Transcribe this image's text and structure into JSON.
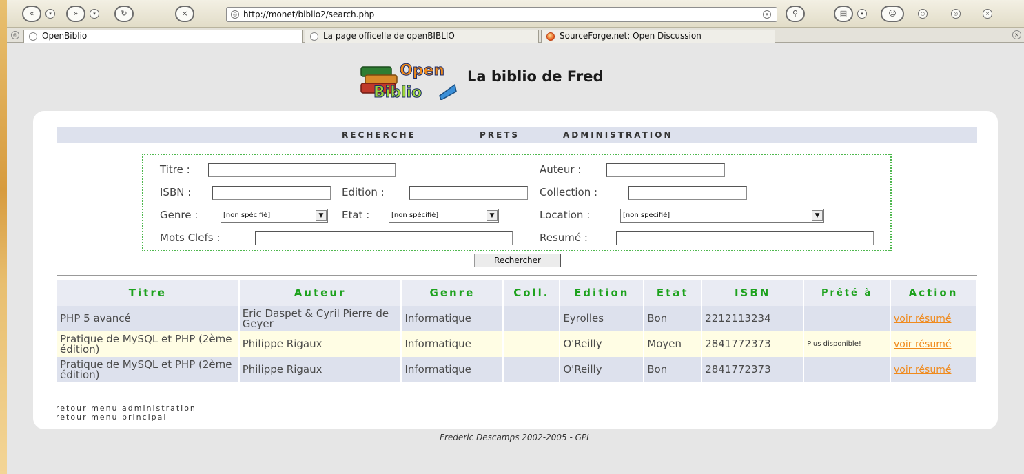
{
  "browser": {
    "url": "http://monet/biblio2/search.php",
    "tabs": [
      {
        "label": "OpenBiblio"
      },
      {
        "label": "La page officelle de openBIBLIO"
      },
      {
        "label": "SourceForge.net: Open Discussion"
      }
    ]
  },
  "header": {
    "logo_text": "Open Biblio",
    "site_title": "La biblio de Fred"
  },
  "menu": {
    "items": [
      "RECHERCHE",
      "PRETS",
      "ADMINISTRATION"
    ]
  },
  "search": {
    "titre_label": "Titre :",
    "auteur_label": "Auteur :",
    "isbn_label": "ISBN :",
    "edition_label": "Edition :",
    "collection_label": "Collection :",
    "genre_label": "Genre :",
    "genre_value": "[non spécifié]",
    "etat_label": "Etat :",
    "etat_value": "[non spécifié]",
    "location_label": "Location :",
    "location_value": "[non spécifié]",
    "motsclefs_label": "Mots Clefs :",
    "resume_label": "Resumé :",
    "button": "Rechercher"
  },
  "results": {
    "columns": [
      "Titre",
      "Auteur",
      "Genre",
      "Coll.",
      "Edition",
      "Etat",
      "ISBN",
      "Prêté à",
      "Action"
    ],
    "rows": [
      {
        "titre": "PHP 5 avancé",
        "auteur": "Eric Daspet & Cyril Pierre de Geyer",
        "genre": "Informatique",
        "coll": "",
        "edition": "Eyrolles",
        "etat": "Bon",
        "isbn": "2212113234",
        "prete": "",
        "action": "voir résumé"
      },
      {
        "titre": "Pratique de MySQL et PHP (2ème édition)",
        "auteur": "Philippe Rigaux",
        "genre": "Informatique",
        "coll": "",
        "edition": "O'Reilly",
        "etat": "Moyen",
        "isbn": "2841772373",
        "prete": "Plus disponible!",
        "action": "voir résumé"
      },
      {
        "titre": "Pratique de MySQL et PHP (2ème édition)",
        "auteur": "Philippe Rigaux",
        "genre": "Informatique",
        "coll": "",
        "edition": "O'Reilly",
        "etat": "Bon",
        "isbn": "2841772373",
        "prete": "",
        "action": "voir résumé"
      }
    ]
  },
  "links": {
    "admin": "retour menu administration",
    "main": "retour menu principal"
  },
  "footer": "Frederic Descamps 2002-2005 - GPL"
}
